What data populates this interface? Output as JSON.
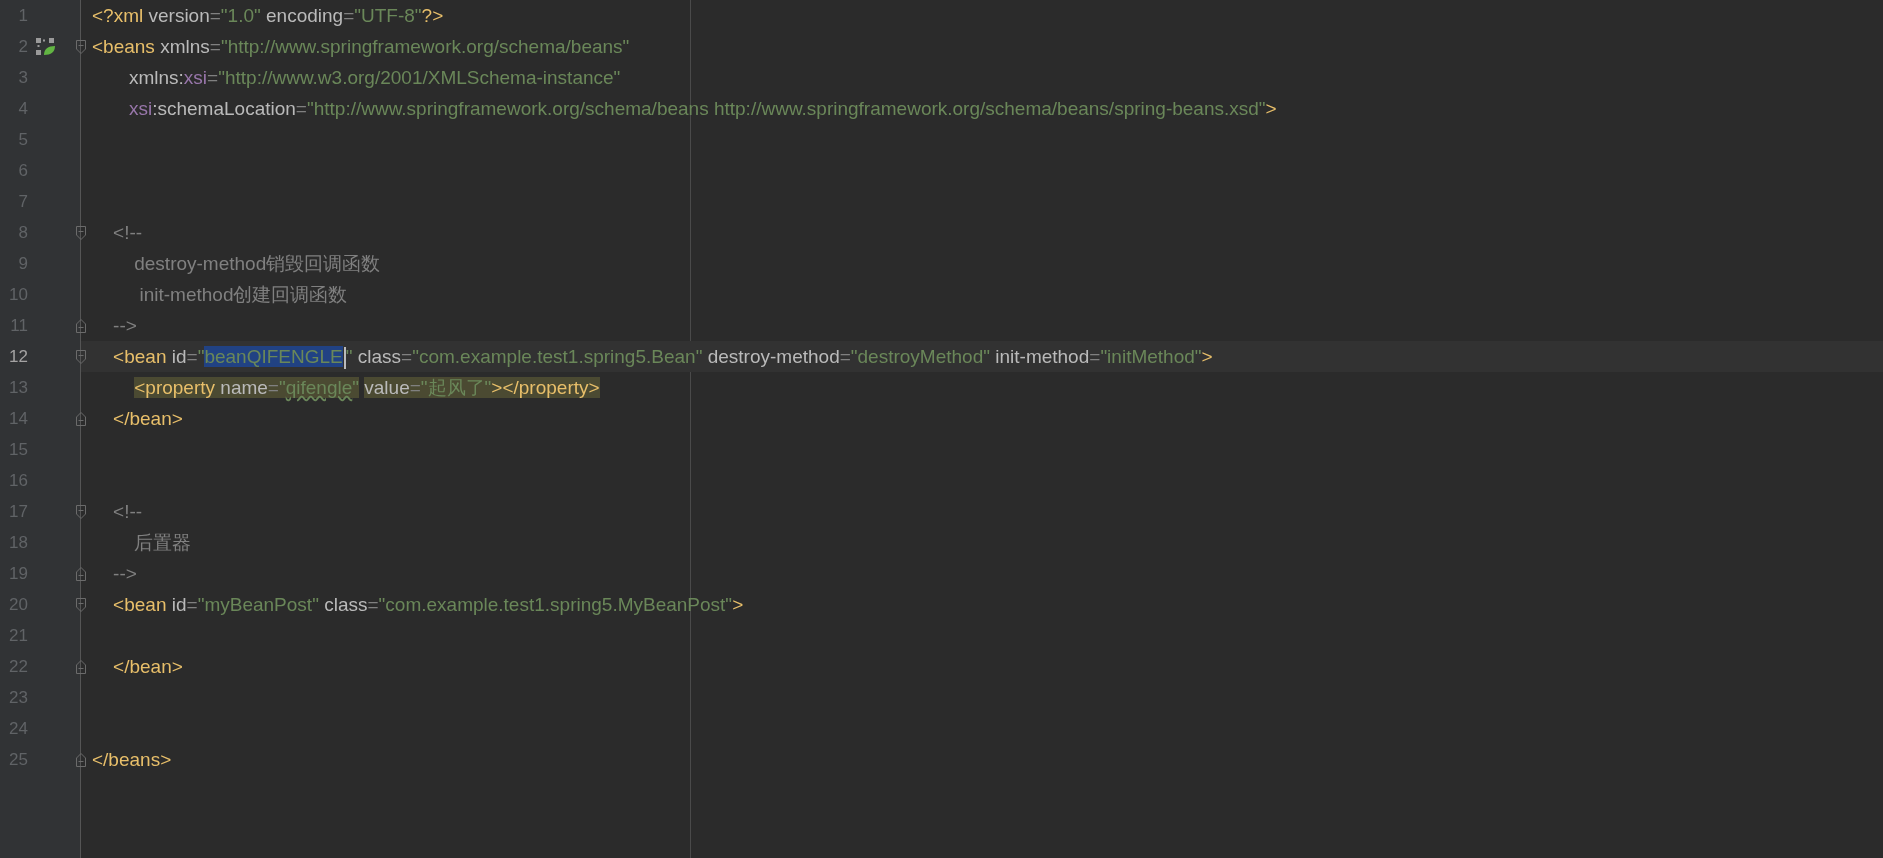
{
  "editor": {
    "lines": [
      {
        "number": "1",
        "tokens": [
          {
            "kind": "tag",
            "text": "<?xml "
          },
          {
            "kind": "attr",
            "text": "version"
          },
          {
            "kind": "eq",
            "text": "="
          },
          {
            "kind": "value",
            "text": "\"1.0\""
          },
          {
            "kind": "attr",
            "text": " encoding"
          },
          {
            "kind": "eq",
            "text": "="
          },
          {
            "kind": "value",
            "text": "\"UTF-8\""
          },
          {
            "kind": "tag",
            "text": "?>"
          }
        ]
      },
      {
        "number": "2",
        "fold_start": true,
        "gutter_icon": true,
        "tokens": [
          {
            "kind": "tag",
            "text": "<beans "
          },
          {
            "kind": "attr",
            "text": "xmlns"
          },
          {
            "kind": "eq",
            "text": "="
          },
          {
            "kind": "value",
            "text": "\"http://www.springframework.org/schema/beans\""
          }
        ]
      },
      {
        "number": "3",
        "tokens": [
          {
            "kind": "attr",
            "text": "       xmlns:"
          },
          {
            "kind": "ns",
            "text": "xsi"
          },
          {
            "kind": "eq",
            "text": "="
          },
          {
            "kind": "value",
            "text": "\"http://www.w3.org/2001/XMLSchema-instance\""
          }
        ]
      },
      {
        "number": "4",
        "tokens": [
          {
            "kind": "ns",
            "text": "       xsi"
          },
          {
            "kind": "attr",
            "text": ":schemaLocation"
          },
          {
            "kind": "eq",
            "text": "="
          },
          {
            "kind": "value",
            "text": "\"http://www.springframework.org/schema/beans http://www.springframework.org/schema/beans/spring-beans.xsd\""
          },
          {
            "kind": "tag",
            "text": ">"
          }
        ]
      },
      {
        "number": "5"
      },
      {
        "number": "6"
      },
      {
        "number": "7"
      },
      {
        "number": "8",
        "fold_start": true,
        "tokens": [
          {
            "kind": "comment",
            "text": "    <!--"
          }
        ]
      },
      {
        "number": "9",
        "tokens": [
          {
            "kind": "comment",
            "text": "        destroy-method销毁回调函数"
          }
        ]
      },
      {
        "number": "10",
        "tokens": [
          {
            "kind": "comment",
            "text": "         init-method创建回调函数"
          }
        ]
      },
      {
        "number": "11",
        "fold_end": true,
        "tokens": [
          {
            "kind": "comment",
            "text": "    -->"
          }
        ]
      },
      {
        "number": "12",
        "fold_start": true,
        "current": true,
        "tokens": [
          {
            "kind": "tag",
            "text": "    <bean "
          },
          {
            "kind": "attr",
            "text": "id"
          },
          {
            "kind": "eq",
            "text": "="
          },
          {
            "kind": "value",
            "text": "\""
          },
          {
            "kind": "value",
            "text": "beanQIFENGLE",
            "selected": true,
            "caret_after": true
          },
          {
            "kind": "value",
            "text": "\""
          },
          {
            "kind": "attr",
            "text": " class"
          },
          {
            "kind": "eq",
            "text": "="
          },
          {
            "kind": "value",
            "text": "\"com.example.test1.spring5.Bean\""
          },
          {
            "kind": "attr",
            "text": " destroy-method"
          },
          {
            "kind": "eq",
            "text": "="
          },
          {
            "kind": "value",
            "text": "\"destroyMethod\""
          },
          {
            "kind": "attr",
            "text": " init-method"
          },
          {
            "kind": "eq",
            "text": "="
          },
          {
            "kind": "value",
            "text": "\"initMethod\""
          },
          {
            "kind": "tag",
            "text": ">"
          }
        ]
      },
      {
        "number": "13",
        "tokens": [
          {
            "kind": "tag",
            "text": "        <property ",
            "matched": true
          },
          {
            "kind": "attr",
            "text": "name",
            "matched": true
          },
          {
            "kind": "eq",
            "text": "=",
            "matched": true
          },
          {
            "kind": "value",
            "text": "\"",
            "matched": true
          },
          {
            "kind": "value",
            "text": "qifengle",
            "matched": true,
            "typo": true
          },
          {
            "kind": "value",
            "text": "\"",
            "matched": true
          },
          {
            "kind": "attr",
            "text": " value",
            "matched": true
          },
          {
            "kind": "eq",
            "text": "=",
            "matched": true
          },
          {
            "kind": "value",
            "text": "\"起风了\"",
            "matched": true
          },
          {
            "kind": "tag",
            "text": "></property>",
            "matched": true
          }
        ]
      },
      {
        "number": "14",
        "fold_end": true,
        "tokens": [
          {
            "kind": "tag",
            "text": "    </bean>"
          }
        ]
      },
      {
        "number": "15"
      },
      {
        "number": "16"
      },
      {
        "number": "17",
        "fold_start": true,
        "tokens": [
          {
            "kind": "comment",
            "text": "    <!--"
          }
        ]
      },
      {
        "number": "18",
        "tokens": [
          {
            "kind": "comment",
            "text": "        后置器"
          }
        ]
      },
      {
        "number": "19",
        "fold_end": true,
        "tokens": [
          {
            "kind": "comment",
            "text": "    -->"
          }
        ]
      },
      {
        "number": "20",
        "fold_start": true,
        "tokens": [
          {
            "kind": "tag",
            "text": "    <bean "
          },
          {
            "kind": "attr",
            "text": "id"
          },
          {
            "kind": "eq",
            "text": "="
          },
          {
            "kind": "value",
            "text": "\"myBeanPost\""
          },
          {
            "kind": "attr",
            "text": " class"
          },
          {
            "kind": "eq",
            "text": "="
          },
          {
            "kind": "value",
            "text": "\"com.example.test1.spring5.MyBeanPost\""
          },
          {
            "kind": "tag",
            "text": ">"
          }
        ]
      },
      {
        "number": "21"
      },
      {
        "number": "22",
        "fold_end": true,
        "tokens": [
          {
            "kind": "tag",
            "text": "    </bean>"
          }
        ]
      },
      {
        "number": "23"
      },
      {
        "number": "24"
      },
      {
        "number": "25",
        "fold_end": true,
        "tokens": [
          {
            "kind": "tag",
            "text": "</beans>"
          }
        ]
      }
    ]
  }
}
